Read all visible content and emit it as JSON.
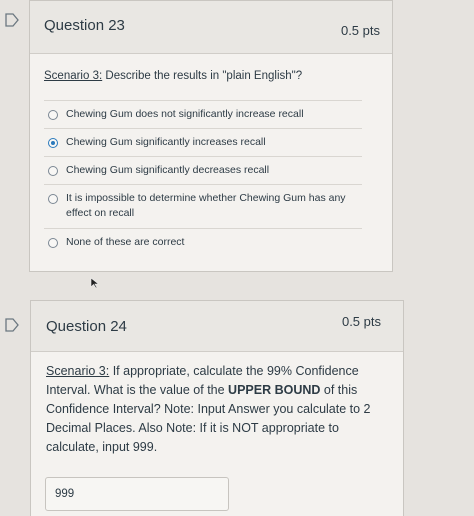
{
  "q23": {
    "title": "Question 23",
    "points": "0.5 pts",
    "prompt_label": "Scenario 3:",
    "prompt_text": " Describe the results in \"plain English\"?",
    "options": [
      {
        "label": "Chewing Gum does not significantly increase recall",
        "selected": false
      },
      {
        "label": "Chewing Gum significantly increases recall",
        "selected": true
      },
      {
        "label": "Chewing Gum significantly decreases recall",
        "selected": false
      },
      {
        "label": "It is impossible to determine whether Chewing Gum has any effect on recall",
        "selected": false
      },
      {
        "label": "None of these are correct",
        "selected": false
      }
    ]
  },
  "q24": {
    "title": "Question 24",
    "points": "0.5 pts",
    "prompt_label": "Scenario 3:",
    "prompt_part1": " If appropriate, calculate the 99% Confidence Interval. What is the value of the ",
    "prompt_bold": "UPPER BOUND",
    "prompt_part2": " of this Confidence Interval? Note: Input Answer you calculate to 2 Decimal Places. Also Note: If it is NOT appropriate to calculate, input 999.",
    "answer_value": "999"
  },
  "icons": {
    "flag": "flag-icon",
    "radio": "radio-button",
    "cursor": "mouse-cursor-icon"
  },
  "colors": {
    "accent": "#2b7abc",
    "text": "#2d3b45",
    "card": "#f4f2ef"
  }
}
